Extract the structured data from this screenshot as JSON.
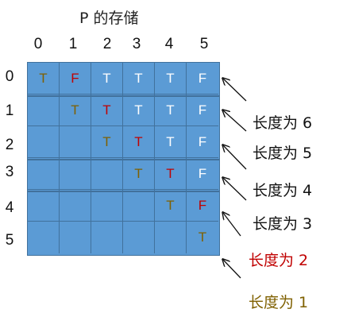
{
  "title": "P 的存储",
  "col_headers": [
    "0",
    "1",
    "2",
    "3",
    "4",
    "5"
  ],
  "row_headers": [
    "0",
    "1",
    "2",
    "3",
    "4",
    "5"
  ],
  "cells": [
    [
      {
        "v": "T",
        "c": "olive"
      },
      {
        "v": "F",
        "c": "red"
      },
      {
        "v": "T",
        "c": "white"
      },
      {
        "v": "T",
        "c": "white"
      },
      {
        "v": "T",
        "c": "white"
      },
      {
        "v": "F",
        "c": "white"
      }
    ],
    [
      {
        "v": "",
        "c": ""
      },
      {
        "v": "T",
        "c": "olive"
      },
      {
        "v": "T",
        "c": "red"
      },
      {
        "v": "T",
        "c": "white"
      },
      {
        "v": "T",
        "c": "white"
      },
      {
        "v": "F",
        "c": "white"
      }
    ],
    [
      {
        "v": "",
        "c": ""
      },
      {
        "v": "",
        "c": ""
      },
      {
        "v": "T",
        "c": "olive"
      },
      {
        "v": "T",
        "c": "red"
      },
      {
        "v": "T",
        "c": "white"
      },
      {
        "v": "F",
        "c": "white"
      }
    ],
    [
      {
        "v": "",
        "c": ""
      },
      {
        "v": "",
        "c": ""
      },
      {
        "v": "",
        "c": ""
      },
      {
        "v": "T",
        "c": "olive"
      },
      {
        "v": "T",
        "c": "red"
      },
      {
        "v": "F",
        "c": "white"
      }
    ],
    [
      {
        "v": "",
        "c": ""
      },
      {
        "v": "",
        "c": ""
      },
      {
        "v": "",
        "c": ""
      },
      {
        "v": "",
        "c": ""
      },
      {
        "v": "T",
        "c": "olive"
      },
      {
        "v": "F",
        "c": "red"
      }
    ],
    [
      {
        "v": "",
        "c": ""
      },
      {
        "v": "",
        "c": ""
      },
      {
        "v": "",
        "c": ""
      },
      {
        "v": "",
        "c": ""
      },
      {
        "v": "",
        "c": ""
      },
      {
        "v": "T",
        "c": "olive"
      }
    ]
  ],
  "colors": {
    "white": "#ffffff",
    "red": "#c00000",
    "olive": "#7f6000",
    "grid_fill": "#5b9bd5",
    "grid_line": "#41719c",
    "label_default": "#111111"
  },
  "labels": [
    {
      "text": "长度为 6",
      "c": "label_default"
    },
    {
      "text": "长度为 5",
      "c": "label_default"
    },
    {
      "text": "长度为 4",
      "c": "label_default"
    },
    {
      "text": "长度为 3",
      "c": "label_default"
    },
    {
      "text": "长度为 2",
      "c": "red"
    },
    {
      "text": "长度为 1",
      "c": "olive"
    }
  ]
}
